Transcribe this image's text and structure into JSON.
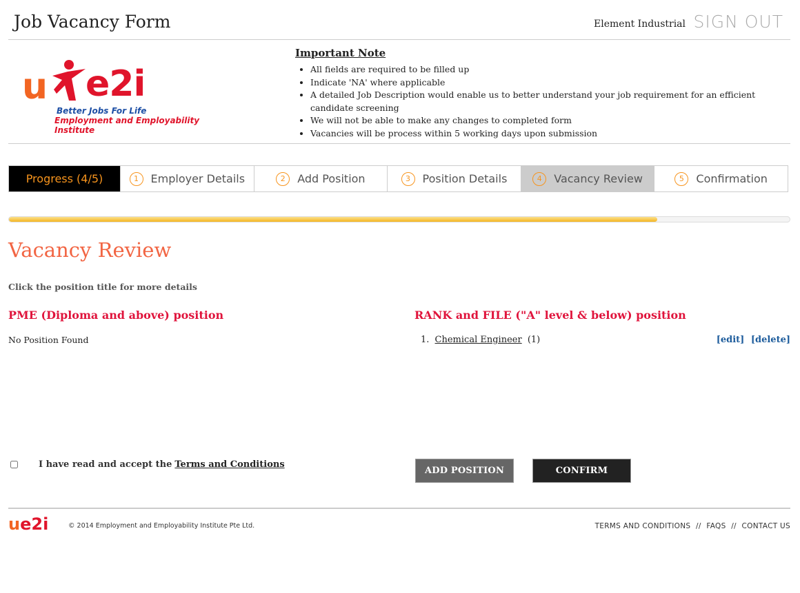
{
  "header": {
    "title": "Job Vacancy Form",
    "company": "Element Industrial",
    "signout_label": "SIGN OUT"
  },
  "logo": {
    "u_text": "u",
    "e2i_text": "e2i",
    "tagline": "Better Jobs For Life",
    "org_name": "Employment and Employability Institute",
    "colors": {
      "orange": "#f26522",
      "red": "#e0142b",
      "blue": "#1d4fa5"
    }
  },
  "note": {
    "title": "Important Note",
    "items": [
      "All fields are required to be filled up",
      "Indicate 'NA' where applicable",
      "A detailed Job Description would enable us to better understand your job requirement for an efficient candidate screening",
      "We will not be able to make any changes to completed form",
      "Vacancies will be process within 5 working days upon submission"
    ]
  },
  "progress": {
    "label": "Progress (4/5)",
    "fraction": 0.83,
    "tabs": [
      {
        "num": "1",
        "label": "Employer Details",
        "active": false
      },
      {
        "num": "2",
        "label": "Add Position",
        "active": false
      },
      {
        "num": "3",
        "label": "Position Details",
        "active": false
      },
      {
        "num": "4",
        "label": "Vacancy Review",
        "active": true
      },
      {
        "num": "5",
        "label": "Confirmation",
        "active": false
      }
    ]
  },
  "main": {
    "title": "Vacancy Review",
    "instruction": "Click the position title for more details",
    "pme": {
      "title": "PME (Diploma and above) position",
      "empty_text": "No Position Found"
    },
    "rank": {
      "title": "RANK and FILE (\"A\" level & below) position",
      "positions": [
        {
          "num": "1.",
          "title": "Chemical Engineer",
          "count": "(1)"
        }
      ],
      "edit_label": "[edit]",
      "delete_label": "[delete]"
    },
    "terms": {
      "text": "I have read and accept the",
      "link": "Terms and Conditions"
    },
    "buttons": {
      "add_position": "ADD POSITION",
      "confirm": "CONFIRM"
    }
  },
  "footer": {
    "logo_u": "u",
    "logo_e2i": "e2i",
    "copyright": "© 2014 Employment and Employability Institute Pte Ltd.",
    "links": [
      "TERMS AND CONDITIONS",
      "FAQS",
      "CONTACT US"
    ],
    "separator": "//"
  }
}
